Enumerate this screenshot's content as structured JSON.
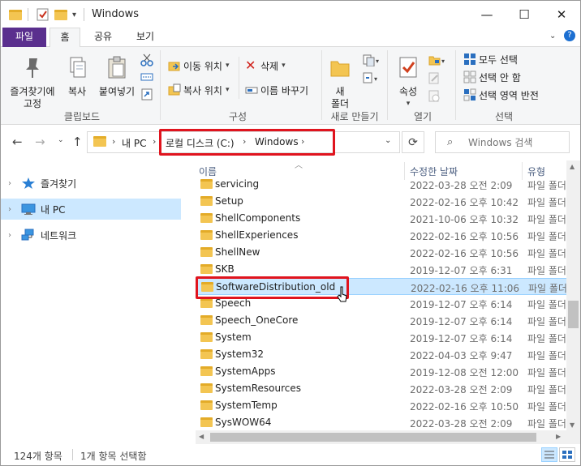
{
  "window": {
    "title": "Windows",
    "minimize": "—",
    "maximize": "☐",
    "close": "✕"
  },
  "tabs": {
    "file": "파일",
    "home": "홈",
    "share": "공유",
    "view": "보기"
  },
  "ribbon": {
    "pin_label": "즐겨찾기에",
    "pin_label2": "고정",
    "copy": "복사",
    "paste": "붙여넣기",
    "group_clipboard": "클립보드",
    "move_to": "이동 위치",
    "copy_to": "복사 위치",
    "delete": "삭제",
    "rename": "이름 바꾸기",
    "group_organize": "구성",
    "new_folder": "새",
    "new_folder2": "폴더",
    "group_new": "새로 만들기",
    "properties": "속성",
    "group_open": "열기",
    "select_all": "모두 선택",
    "select_none": "선택 안 함",
    "invert_selection": "선택 영역 반전",
    "group_select": "선택"
  },
  "address": {
    "crumbs": [
      "내 PC",
      "로컬 디스크 (C:)",
      "Windows"
    ],
    "search_placeholder": "Windows 검색"
  },
  "nav": {
    "items": [
      {
        "label": "즐겨찾기"
      },
      {
        "label": "내 PC"
      },
      {
        "label": "네트워크"
      }
    ]
  },
  "columns": {
    "name": "이름",
    "date": "수정한 날짜",
    "type": "유형"
  },
  "files": [
    {
      "name": "servicing",
      "date": "2022-03-28 오전 2:09",
      "type": "파일 폴더"
    },
    {
      "name": "Setup",
      "date": "2022-02-16 오후 10:42",
      "type": "파일 폴더"
    },
    {
      "name": "ShellComponents",
      "date": "2021-10-06 오후 10:32",
      "type": "파일 폴더"
    },
    {
      "name": "ShellExperiences",
      "date": "2022-02-16 오후 10:56",
      "type": "파일 폴더"
    },
    {
      "name": "ShellNew",
      "date": "2022-02-16 오후 10:56",
      "type": "파일 폴더"
    },
    {
      "name": "SKB",
      "date": "2019-12-07 오후 6:31",
      "type": "파일 폴더"
    },
    {
      "name": "SoftwareDistribution_old",
      "date": "2022-02-16 오후 11:06",
      "type": "파일 폴더"
    },
    {
      "name": "Speech",
      "date": "2019-12-07 오후 6:14",
      "type": "파일 폴더"
    },
    {
      "name": "Speech_OneCore",
      "date": "2019-12-07 오후 6:14",
      "type": "파일 폴더"
    },
    {
      "name": "System",
      "date": "2019-12-07 오후 6:14",
      "type": "파일 폴더"
    },
    {
      "name": "System32",
      "date": "2022-04-03 오후 9:47",
      "type": "파일 폴더"
    },
    {
      "name": "SystemApps",
      "date": "2019-12-08 오전 12:00",
      "type": "파일 폴더"
    },
    {
      "name": "SystemResources",
      "date": "2022-03-28 오전 2:09",
      "type": "파일 폴더"
    },
    {
      "name": "SystemTemp",
      "date": "2022-02-16 오후 10:50",
      "type": "파일 폴더"
    },
    {
      "name": "SysWOW64",
      "date": "2022-03-28 오전 2:09",
      "type": "파일 폴더"
    }
  ],
  "status": {
    "count": "124개 항목",
    "selected": "1개 항목 선택함"
  },
  "colors": {
    "file_tab": "#5a2f8e",
    "selection": "#cce8ff",
    "highlight": "#e0141e",
    "folder": "#f3c552"
  }
}
